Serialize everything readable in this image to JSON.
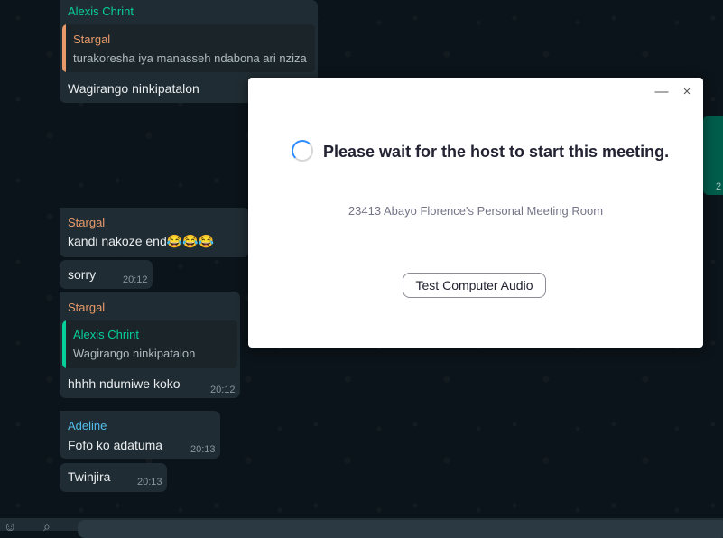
{
  "colors": {
    "chat_background": "#0b141a",
    "incoming_bubble": "#202c33",
    "outgoing_bubble": "#005c4b",
    "name_alexis": "#06cf9c",
    "name_stargal": "#e89a6b",
    "name_adeline": "#53bdeb",
    "spinner_accent": "#2d8cff"
  },
  "chat": {
    "messages": [
      {
        "sender": "Alexis Chrint",
        "quote": {
          "name": "Stargal",
          "text": "turakoresha iya manasseh ndabona ari nziza"
        },
        "text": "Wagirango ninkipatalon"
      },
      {
        "sender": "Stargal",
        "text": "kandi nakoze end😂😂😂"
      },
      {
        "text": "sorry",
        "time": "20:12"
      },
      {
        "sender": "Stargal",
        "quote": {
          "name": "Alexis Chrint",
          "text": "Wagirango ninkipatalon"
        },
        "text": "hhhh ndumiwe koko",
        "time": "20:12"
      },
      {
        "sender": "Adeline",
        "text": "Fofo ko adatuma",
        "time": "20:13"
      },
      {
        "text": "Twinjira",
        "time": "20:13"
      }
    ],
    "partial_time": "2"
  },
  "dialog": {
    "status": "Please wait for the host to start this meeting.",
    "room": "23413 Abayo Florence's Personal Meeting Room",
    "test_audio_label": "Test Computer Audio",
    "minimize_label": "—",
    "close_label": "×",
    "spinner_icon": "loading-spinner-icon"
  }
}
